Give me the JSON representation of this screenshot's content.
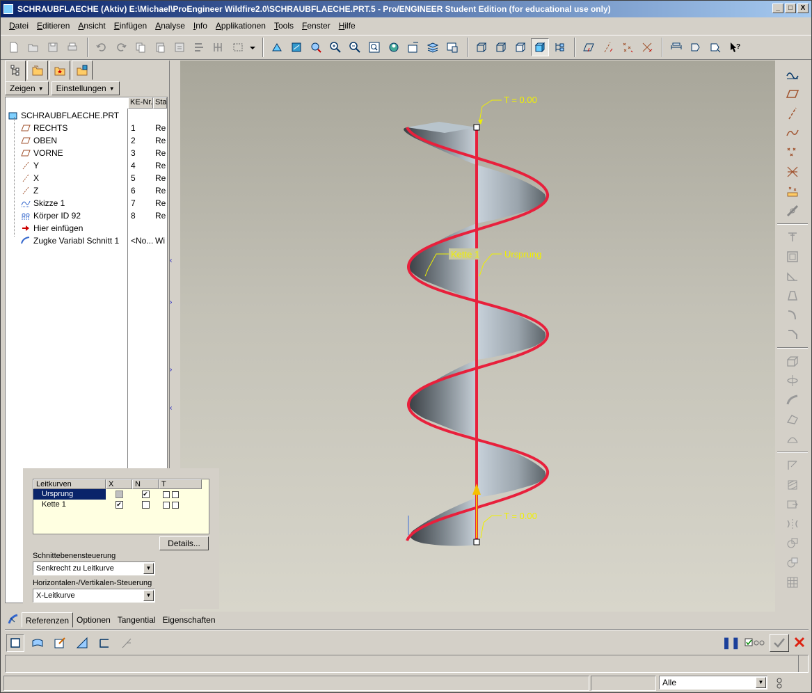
{
  "window": {
    "title": "SCHRAUBFLAECHE (Aktiv) E:\\Michael\\ProEngineer Wildfire2.0\\SCHRAUBFLAECHE.PRT.5 - Pro/ENGINEER Student Edition (for educational use only)",
    "buttons": [
      "_",
      "□",
      "X"
    ]
  },
  "menu": [
    "Datei",
    "Editieren",
    "Ansicht",
    "Einfügen",
    "Analyse",
    "Info",
    "Applikationen",
    "Tools",
    "Fenster",
    "Hilfe"
  ],
  "left_panel": {
    "show_button": "Zeigen",
    "settings_button": "Einstellungen",
    "columns": [
      "KE-Nr.",
      "Sta"
    ],
    "root": "SCHRAUBFLAECHE.PRT",
    "items": [
      {
        "name": "RECHTS",
        "id": "1",
        "status": "Re",
        "icon": "datum-plane-icon"
      },
      {
        "name": "OBEN",
        "id": "2",
        "status": "Re",
        "icon": "datum-plane-icon"
      },
      {
        "name": "VORNE",
        "id": "3",
        "status": "Re",
        "icon": "datum-plane-icon"
      },
      {
        "name": "Y",
        "id": "4",
        "status": "Re",
        "icon": "datum-axis-icon"
      },
      {
        "name": "X",
        "id": "5",
        "status": "Re",
        "icon": "datum-axis-icon"
      },
      {
        "name": "Z",
        "id": "6",
        "status": "Re",
        "icon": "datum-axis-icon"
      },
      {
        "name": "Skizze 1",
        "id": "7",
        "status": "Re",
        "icon": "sketch-icon"
      },
      {
        "name": "Körper ID 92",
        "id": "8",
        "status": "Re",
        "icon": "body-icon"
      },
      {
        "name": "Hier einfügen",
        "id": "",
        "status": "",
        "icon": "insert-here-icon"
      },
      {
        "name": "Zugke Variabl Schnitt 1",
        "id": "<No...",
        "status": "Wi",
        "icon": "sweep-icon"
      }
    ]
  },
  "viewport": {
    "labels": {
      "t_top": "T = 0.00",
      "kette": "Kette 1",
      "ursprung": "Ursprung",
      "t_bottom": "T = 0.00"
    },
    "colors": {
      "curve": "#e8203c",
      "surface": "#8a9298",
      "annotation": "#f0f000"
    }
  },
  "references": {
    "table_headers": [
      "Leitkurven",
      "X",
      "N",
      "T"
    ],
    "rows": [
      {
        "name": "Ursprung",
        "x": false,
        "n": true,
        "selected": true
      },
      {
        "name": "Kette 1",
        "x": true,
        "n": false,
        "selected": false
      }
    ],
    "details_button": "Details...",
    "section_label": "Schnittebenensteuerung",
    "section_value": "Senkrecht zu Leitkurve",
    "hv_label": "Horizontalen-/Vertikalen-Steuerung",
    "hv_value": "X-Leitkurve"
  },
  "dashboard_tabs": [
    "Referenzen",
    "Optionen",
    "Tangential",
    "Eigenschaften"
  ],
  "status": {
    "filter": "Alle"
  }
}
